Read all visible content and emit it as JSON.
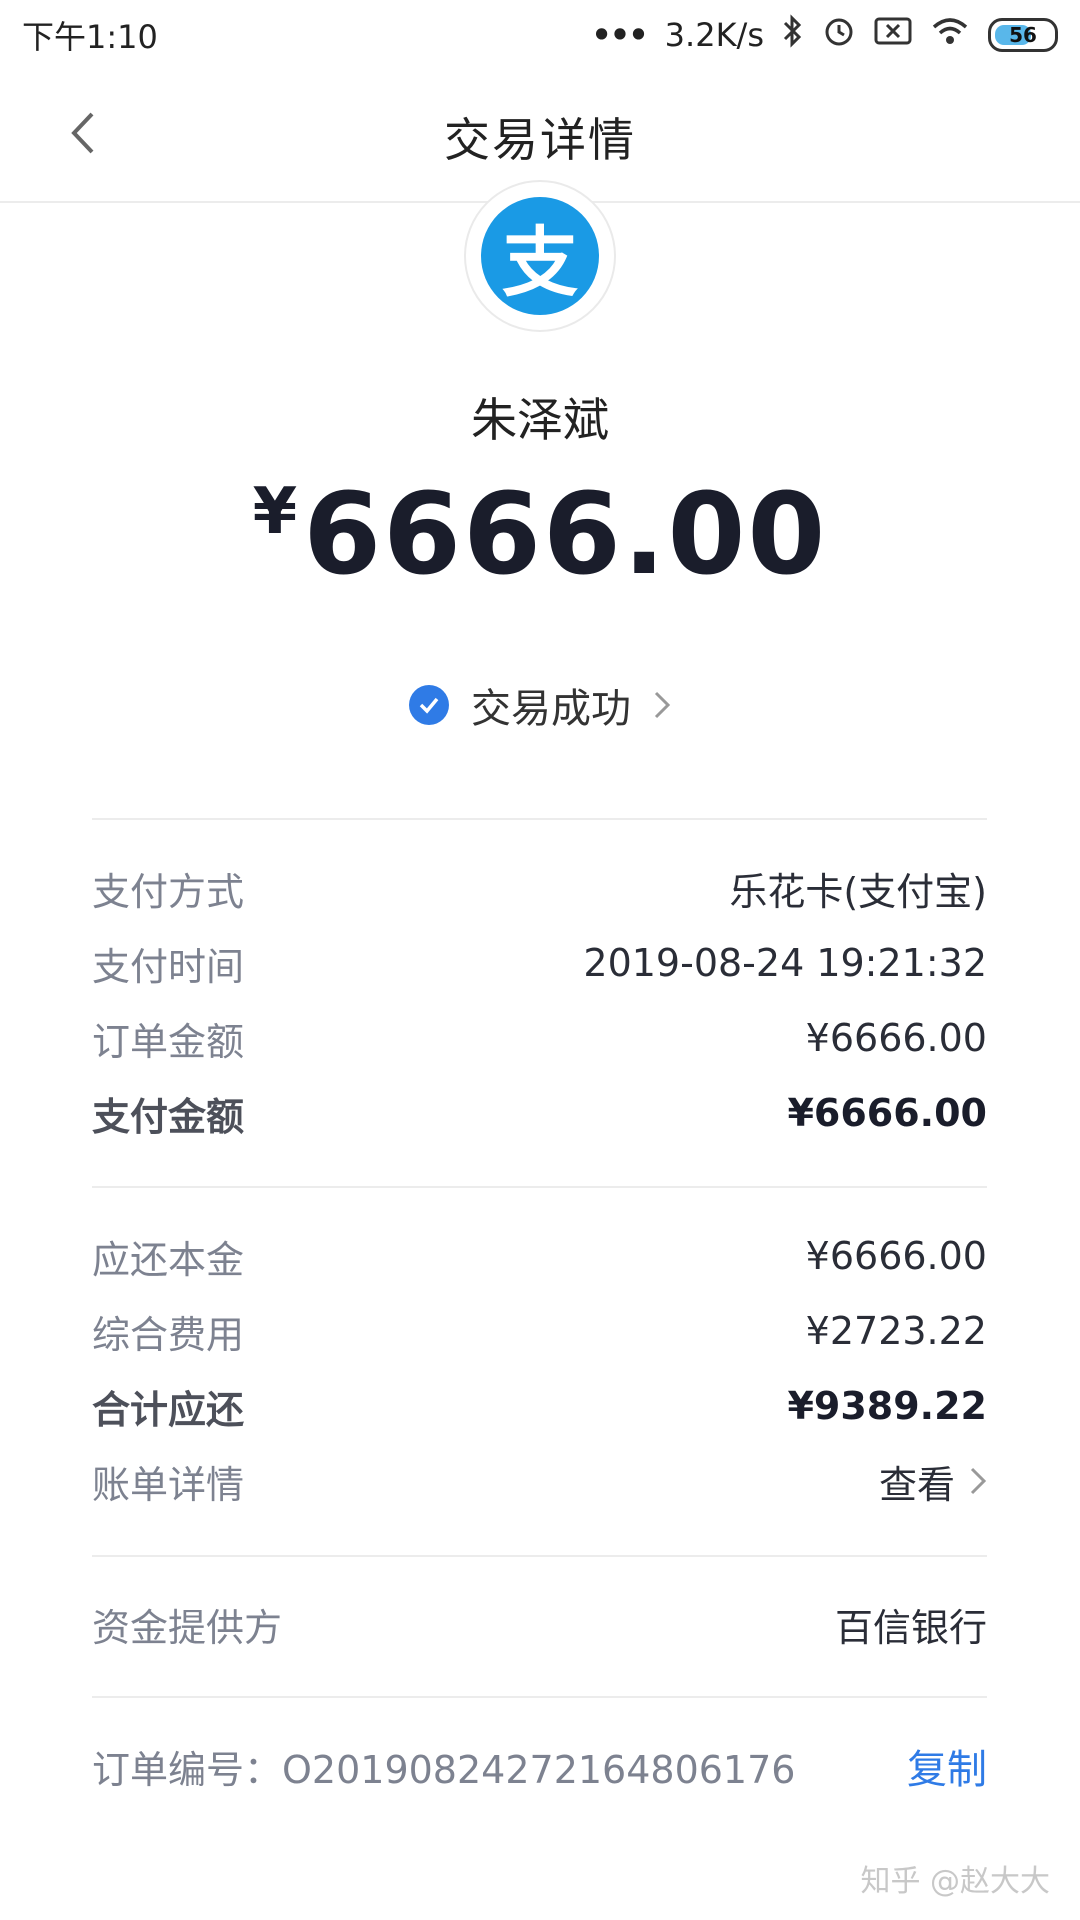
{
  "status_bar": {
    "time": "下午1:10",
    "network_speed": "3.2K/s",
    "battery": "56"
  },
  "nav": {
    "title": "交易详情"
  },
  "merchant": {
    "logo_char": "支",
    "payee": "朱泽斌"
  },
  "amount": {
    "currency": "¥",
    "value": "6666.00"
  },
  "status": {
    "text": "交易成功"
  },
  "payment_info": [
    {
      "label": "支付方式",
      "value": "乐花卡(支付宝)"
    },
    {
      "label": "支付时间",
      "value": "2019-08-24 19:21:32"
    },
    {
      "label": "订单金额",
      "value": "¥6666.00"
    },
    {
      "label": "支付金额",
      "value": "¥6666.00"
    }
  ],
  "repayment_info": [
    {
      "label": "应还本金",
      "value": "¥6666.00"
    },
    {
      "label": "综合费用",
      "value": "¥2723.22"
    },
    {
      "label": "合计应还",
      "value": "¥9389.22"
    },
    {
      "label": "账单详情",
      "value": "查看"
    }
  ],
  "provider": {
    "label": "资金提供方",
    "value": "百信银行"
  },
  "order": {
    "label": "订单编号：",
    "number": "O20190824272164806176",
    "copy_label": "复制"
  },
  "watermark": "知乎 @赵大大",
  "colors": {
    "accent": "#2f7be6",
    "logo_blue": "#1a9ae5"
  }
}
